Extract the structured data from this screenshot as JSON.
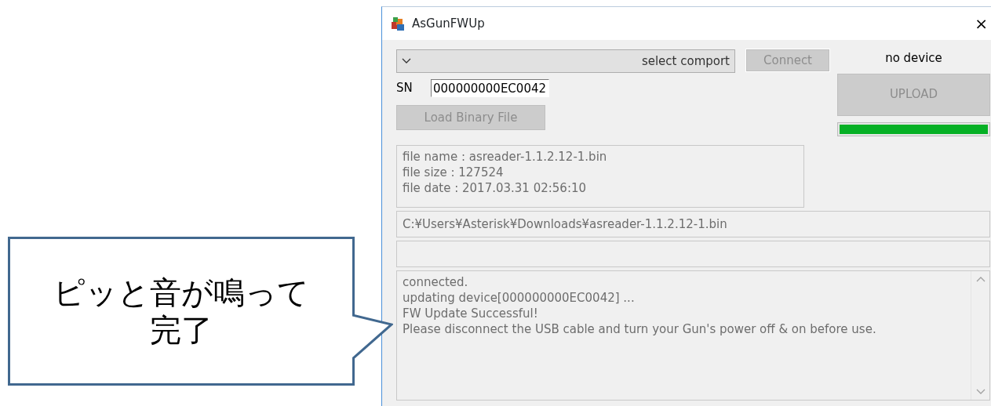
{
  "annotation": {
    "lines": [
      "ピッと音が鳴って",
      "完了"
    ]
  },
  "window": {
    "title": "AsGunFWUp",
    "close": "×"
  },
  "comport": {
    "value": "select comport"
  },
  "connect_button": {
    "label": "Connect",
    "disabled": true
  },
  "device_status": "no device",
  "upload_button": {
    "label": "UPLOAD",
    "disabled": true
  },
  "progress": {
    "level": 1
  },
  "sn": {
    "label": "SN",
    "value": "000000000EC0042"
  },
  "load_button": {
    "label": "Load Binary File",
    "disabled": true
  },
  "file_info": [
    "file name : asreader-1.1.2.12-1.bin",
    "file size : 127524",
    "file date : 2017.03.31 02:56:10"
  ],
  "path": "C:¥Users¥Asterisk¥Downloads¥asreader-1.1.2.12-1.bin",
  "log": [
    "connected.",
    "updating device[000000000EC0042] ...",
    "FW Update Successful!",
    "Please disconnect the USB cable and turn your Gun's power off & on before use."
  ]
}
